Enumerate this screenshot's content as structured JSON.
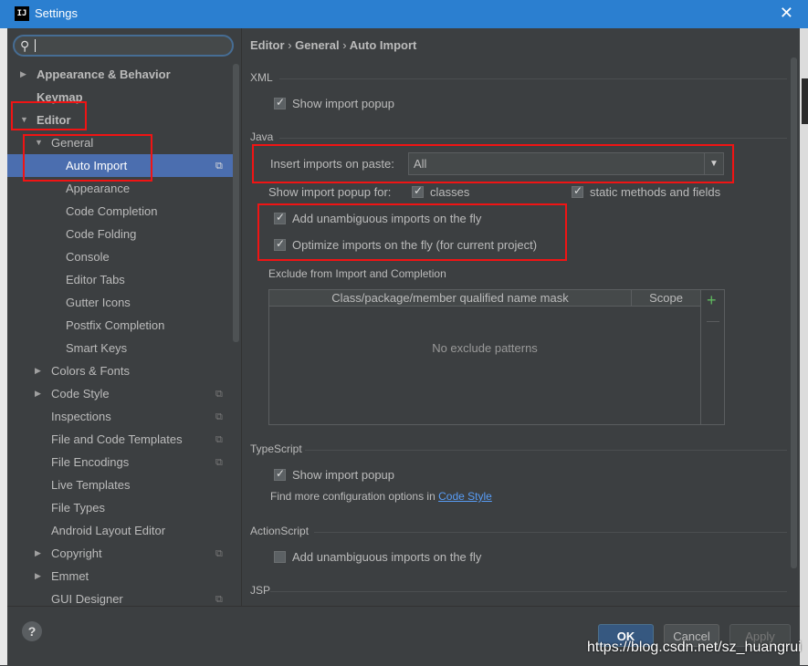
{
  "window": {
    "title": "Settings",
    "logo": "IJ"
  },
  "search": {
    "value": "",
    "placeholder": ""
  },
  "sidebar": {
    "items": [
      {
        "label": "Appearance & Behavior"
      },
      {
        "label": "Keymap"
      },
      {
        "label": "Editor"
      },
      {
        "label": "General"
      },
      {
        "label": "Auto Import"
      },
      {
        "label": "Appearance"
      },
      {
        "label": "Code Completion"
      },
      {
        "label": "Code Folding"
      },
      {
        "label": "Console"
      },
      {
        "label": "Editor Tabs"
      },
      {
        "label": "Gutter Icons"
      },
      {
        "label": "Postfix Completion"
      },
      {
        "label": "Smart Keys"
      },
      {
        "label": "Colors & Fonts"
      },
      {
        "label": "Code Style"
      },
      {
        "label": "Inspections"
      },
      {
        "label": "File and Code Templates"
      },
      {
        "label": "File Encodings"
      },
      {
        "label": "Live Templates"
      },
      {
        "label": "File Types"
      },
      {
        "label": "Android Layout Editor"
      },
      {
        "label": "Copyright"
      },
      {
        "label": "Emmet"
      },
      {
        "label": "GUI Designer"
      }
    ]
  },
  "breadcrumb": {
    "part1": "Editor",
    "part2": "General",
    "part3": "Auto Import",
    "separator": "›"
  },
  "xml": {
    "section": "XML",
    "show_popup": "Show import popup"
  },
  "java": {
    "section": "Java",
    "insert_label": "Insert imports on paste:",
    "insert_value": "All",
    "show_popup_for": "Show import popup for:",
    "classes": "classes",
    "static_methods": "static methods and fields",
    "add_unambiguous": "Add unambiguous imports on the fly",
    "optimize": "Optimize imports on the fly (for current project)",
    "exclude_section": "Exclude from Import and Completion",
    "table_col1": "Class/package/member qualified name mask",
    "table_col2": "Scope",
    "table_empty": "No exclude patterns",
    "add_btn": "+",
    "remove_btn": "—"
  },
  "typescript": {
    "section": "TypeScript",
    "show_popup": "Show import popup",
    "find_more": "Find more configuration options in",
    "link": "Code Style"
  },
  "actionscript": {
    "section": "ActionScript",
    "add_unambiguous": "Add unambiguous imports on the fly"
  },
  "jsp": {
    "section": "JSP"
  },
  "buttons": {
    "help": "?",
    "ok": "OK",
    "cancel": "Cancel",
    "apply": "Apply"
  },
  "watermark": "https://blog.csdn.net/sz_huangrui",
  "colors": {
    "accent": "#4b6eaf",
    "titlebar": "#2b7fd0",
    "highlight_box": "#f01414",
    "link": "#589df6"
  }
}
